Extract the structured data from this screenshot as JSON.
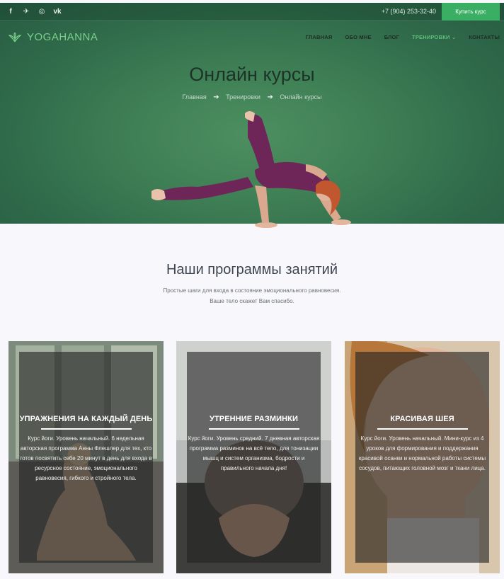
{
  "topbar": {
    "social": [
      {
        "icon": "facebook-icon",
        "glyph": "f"
      },
      {
        "icon": "telegram-icon",
        "glyph": "✈"
      },
      {
        "icon": "instagram-icon",
        "glyph": "◎"
      },
      {
        "icon": "vk-icon",
        "glyph": "vk"
      }
    ],
    "phone": "+7 (904) 253-32-40",
    "buy_button": "Купить курс"
  },
  "logo": {
    "text": "YOGAHANNA"
  },
  "nav": {
    "items": [
      "ГЛАВНАЯ",
      "ОБО МНЕ",
      "БЛОГ",
      "ТРЕНИРОВКИ ⌄",
      "КОНТАКТЫ"
    ],
    "active_index": 3
  },
  "hero": {
    "title": "Онлайн курсы",
    "breadcrumb": [
      "Главная",
      "Тренировки",
      "Онлайн курсы"
    ],
    "breadcrumb_separator": "➔"
  },
  "programs": {
    "title": "Наши программы занятий",
    "subtitle_line1": "Простые шаги для входа в состояние эмоционального равновесия.",
    "subtitle_line2": "Ваше тело скажет Вам спасибо.",
    "cards": [
      {
        "title": "УПРАЖНЕНИЯ НА КАЖДЫЙ ДЕНЬ",
        "text": "Курс йоги. Уровень начальный. 6 недельная авторская программа Анны Флешлер для тех, кто готов посвятить себе 20 минут в день для входа в ресурсное состояние, эмоционального равновесия, гибкого и стройного тела."
      },
      {
        "title": "УТРЕННИЕ РАЗМИНКИ",
        "text": "Курс йоги. Уровень средний. 7 дневная авторская программа разминок на всё тело, для тонизации мышц и систем организма, бодрости и правильного начала дня!"
      },
      {
        "title": "КРАСИВАЯ ШЕЯ",
        "text": "Курс йоги. Уровень начальный. Мини-курс из 4 уроков для формирования и поддержания красивой осанки и нормальной работы системы сосудов, питающих головной мозг и ткани лица."
      }
    ]
  },
  "colors": {
    "accent": "#3aae63",
    "hero_green": "#3f7f55",
    "logo_green": "#7ccf8b"
  }
}
